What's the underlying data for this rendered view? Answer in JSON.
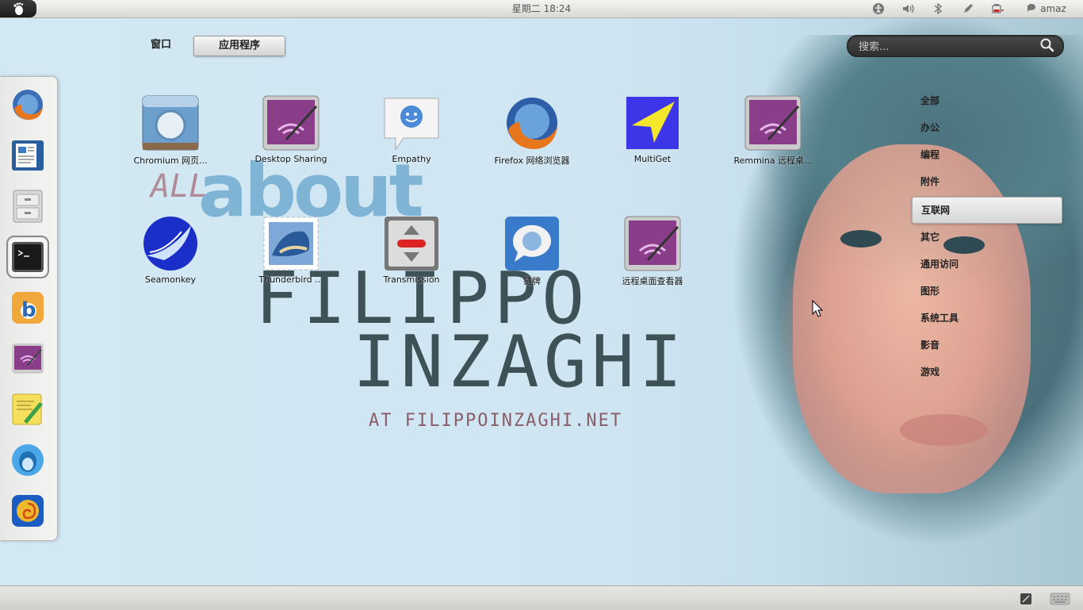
{
  "top_panel": {
    "clock": "星期二 18:24",
    "user": "amaz"
  },
  "tabs": {
    "windows": "窗口",
    "applications": "应用程序"
  },
  "search": {
    "placeholder": "搜索..."
  },
  "wallpaper": {
    "all": "ALL",
    "about": "about",
    "name1": "FILIPPO",
    "name2": "INZAGHI",
    "site": "AT FILIPPOINZAGHI.NET"
  },
  "apps": [
    {
      "label": "Chromium 网页...",
      "icon": "chromium-icon"
    },
    {
      "label": "Desktop Sharing",
      "icon": "desktop-sharing-icon"
    },
    {
      "label": "Empathy",
      "icon": "empathy-icon"
    },
    {
      "label": "Firefox 网络浏览器",
      "icon": "firefox-icon"
    },
    {
      "label": "MultiGet",
      "icon": "multiget-icon"
    },
    {
      "label": "Remmina 远程桌...",
      "icon": "remmina-icon"
    },
    {
      "label": "Seamonkey",
      "icon": "seamonkey-icon"
    },
    {
      "label": "Thunderbird ...",
      "icon": "thunderbird-icon"
    },
    {
      "label": "Transmission",
      "icon": "transmission-icon"
    },
    {
      "label": "链牌",
      "icon": "chat-bubble-icon"
    },
    {
      "label": "远程桌面查看器",
      "icon": "remote-desktop-viewer-icon"
    }
  ],
  "categories": [
    {
      "label": "全部"
    },
    {
      "label": "办公"
    },
    {
      "label": "编程"
    },
    {
      "label": "附件"
    },
    {
      "label": "互联网",
      "selected": true
    },
    {
      "label": "其它"
    },
    {
      "label": "通用访问"
    },
    {
      "label": "图形"
    },
    {
      "label": "系统工具"
    },
    {
      "label": "影音"
    },
    {
      "label": "游戏"
    }
  ],
  "dock": [
    {
      "icon": "firefox-icon"
    },
    {
      "icon": "writer-document-icon"
    },
    {
      "icon": "file-cabinet-icon"
    },
    {
      "icon": "terminal-icon",
      "active": true
    },
    {
      "icon": "b-app-icon"
    },
    {
      "icon": "remmina-icon"
    },
    {
      "icon": "notes-pencil-icon"
    },
    {
      "icon": "qq-penguin-icon"
    },
    {
      "icon": "swirl-app-icon"
    }
  ],
  "colors": {
    "panel": "#dcdcd8",
    "purple_icon": "#8a3e8a",
    "selected_category": "#e2e2e2",
    "wallpaper_blue": "#cfe6f2"
  }
}
